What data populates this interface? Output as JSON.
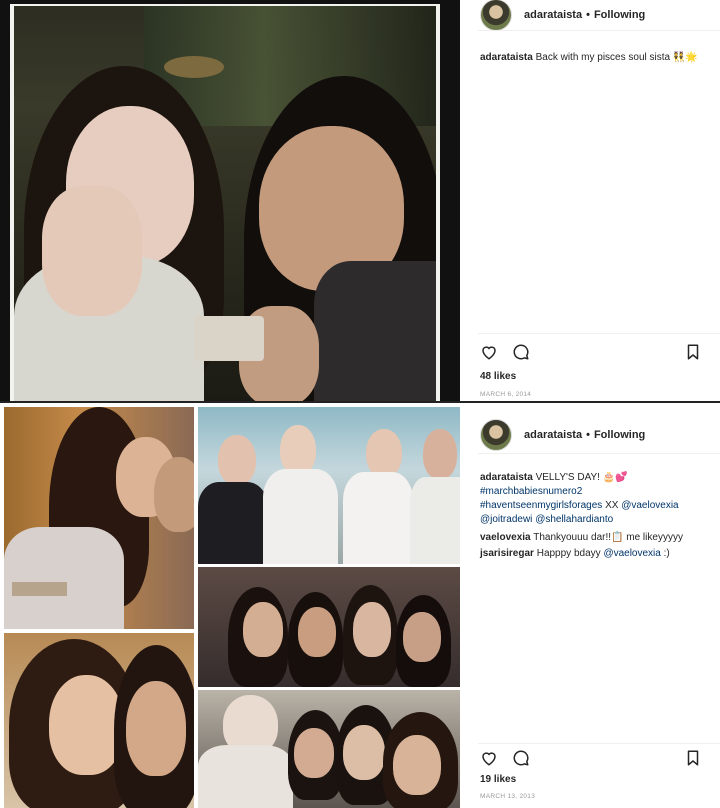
{
  "posts": [
    {
      "username": "adarataista",
      "following": "Following",
      "caption": {
        "username": "adarataista",
        "text": "Back with my pisces soul sista 👯🌟"
      },
      "likes": "48 likes",
      "date": "MARCH 6, 2014"
    },
    {
      "username": "adarataista",
      "following": "Following",
      "caption": {
        "username": "adarataista",
        "text": "VELLY'S DAY! 🎂💕",
        "hashtags": [
          "#marchbabiesnumero2",
          "#haventseenmygirlsforages"
        ],
        "after_hashtags": " XX ",
        "mentions": [
          "@vaelovexia",
          "@joitradewi",
          "@shellahardianto"
        ]
      },
      "comments": [
        {
          "username": "vaelovexia",
          "text": " Thankyouuu dar!!📋 me likeyyyyy"
        },
        {
          "username": "jsarisiregar",
          "text": " Happpy bdayy ",
          "mention": "@vaelovexia",
          "tail": " :)"
        }
      ],
      "likes": "19 likes",
      "date": "MARCH 13, 2013"
    }
  ],
  "icons": [
    "heart-icon",
    "comment-icon",
    "bookmark-icon"
  ]
}
